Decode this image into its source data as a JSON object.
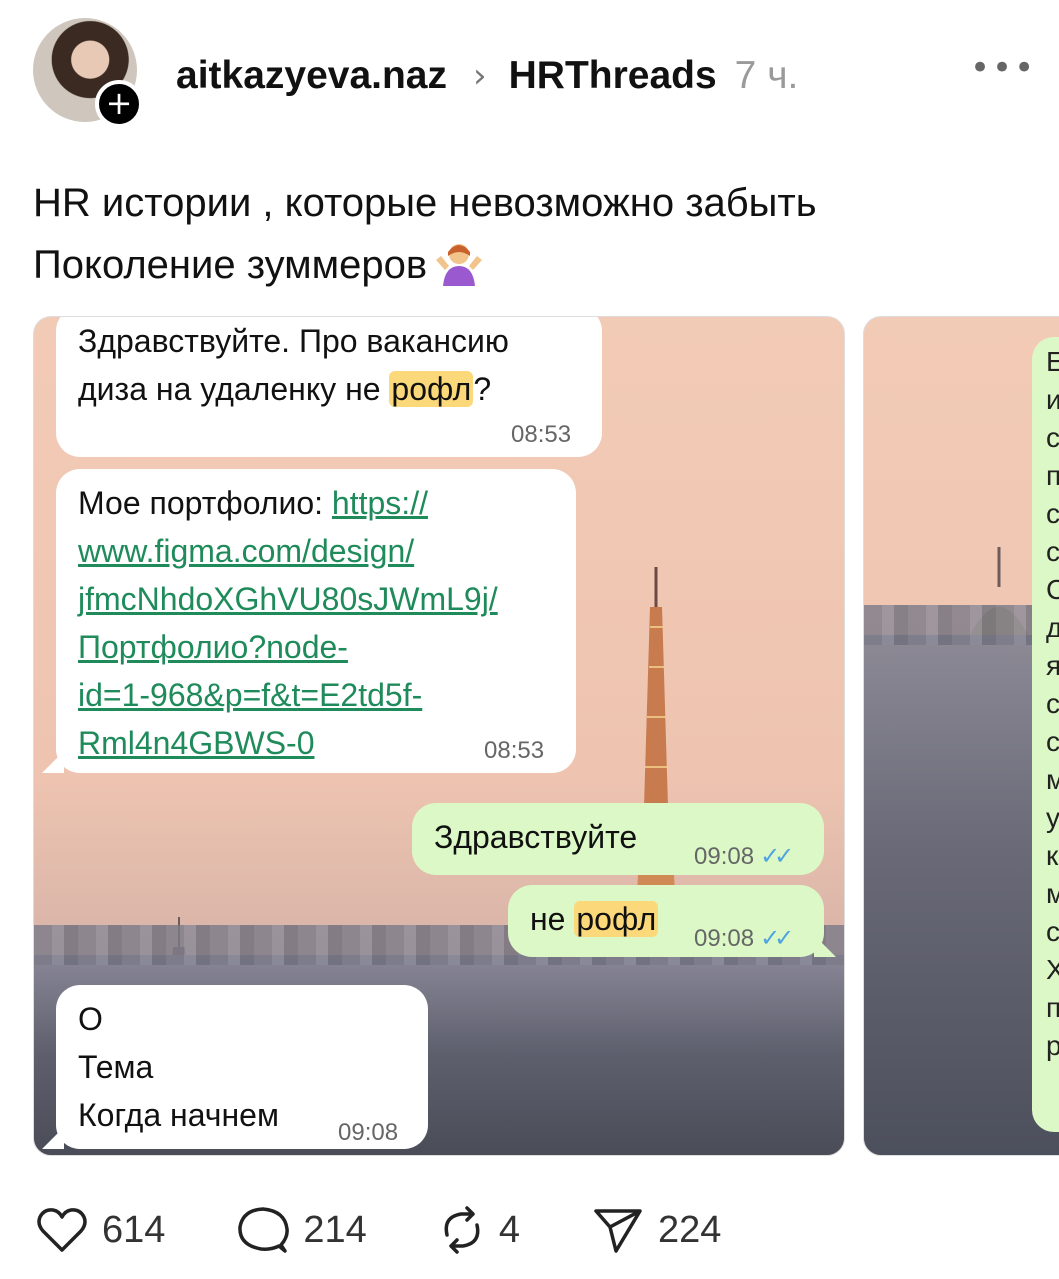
{
  "header": {
    "username": "aitkazyeva.naz",
    "separator": "›",
    "group": "HRThreads",
    "time": "7 ч.",
    "more": "•••",
    "follow": "+"
  },
  "post": {
    "line1": "HR истории , которые невозможно забыть",
    "line2": "Поколение зуммеров"
  },
  "chat": {
    "msg1": {
      "line1": "Здравствуйте. Про вакансию",
      "line2_pre": "диза на удаленку не ",
      "highlight": "рофл",
      "line2_post": "?",
      "time": "08:53"
    },
    "msg2": {
      "label": "Мое портфолио: ",
      "link1": "https://",
      "link2": "www.figma.com/design/",
      "link3": "jfmcNhdoXGhVU80sJWmL9j/",
      "link4": "Портфолио?node-",
      "link5": "id=1-968&p=f&t=E2td5f-",
      "link6": "Rml4n4GBWS-0",
      "time": "08:53"
    },
    "msg3": {
      "text": "Здравствуйте",
      "time": "09:08",
      "ticks": "✓✓"
    },
    "msg4": {
      "pre": "не ",
      "highlight": "рофл",
      "time": "09:08",
      "ticks": "✓✓"
    },
    "msg5": {
      "line1": "О",
      "line2": "Тема",
      "line3": "Когда начнем",
      "time": "09:08"
    }
  },
  "card2": {
    "letters": [
      "Е",
      "и",
      "с",
      "п",
      "с",
      "с",
      "С",
      "д",
      "я",
      "с",
      "с",
      "м",
      "у",
      "к",
      "м",
      "с",
      "Х",
      "п",
      "р"
    ]
  },
  "actions": {
    "likes": "614",
    "comments": "214",
    "reposts": "4",
    "shares": "224"
  }
}
